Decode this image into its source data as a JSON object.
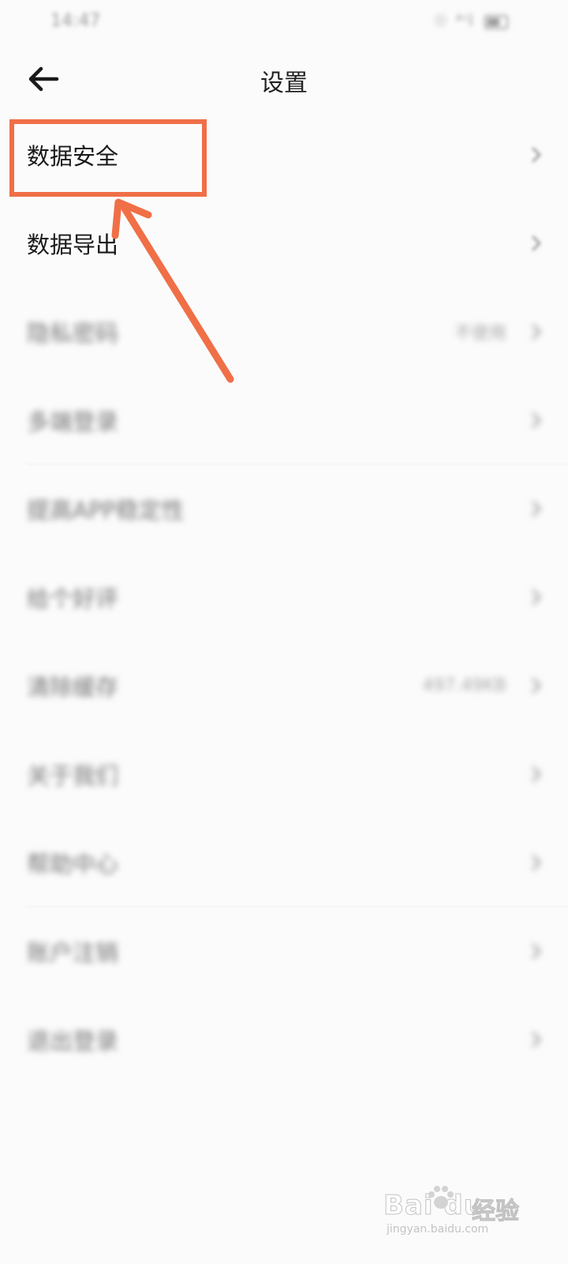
{
  "status_bar": {
    "time": "14:47",
    "icons": "☉ ᴬᴵl"
  },
  "nav": {
    "title": "设置"
  },
  "settings": [
    {
      "label": "数据安全",
      "value": "",
      "clear": true
    },
    {
      "label": "数据导出",
      "value": "",
      "clear": true
    },
    {
      "label": "隐私密码",
      "value": "不使用",
      "clear": false
    },
    {
      "label": "多端登录",
      "value": "",
      "clear": false
    },
    {
      "label": "提高APP稳定性",
      "value": "",
      "clear": false
    },
    {
      "label": "给个好评",
      "value": "",
      "clear": false
    },
    {
      "label": "清除缓存",
      "value": "497.49KB",
      "clear": false
    },
    {
      "label": "关于我们",
      "value": "",
      "clear": false
    },
    {
      "label": "帮助中心",
      "value": "",
      "clear": false
    },
    {
      "label": "账户注销",
      "value": "",
      "clear": false
    },
    {
      "label": "退出登录",
      "value": "",
      "clear": false
    }
  ],
  "battery_level": 0.7,
  "watermark": {
    "brand": "Bai du",
    "cn": "经验",
    "url": "jingyan.baidu.com"
  },
  "colors": {
    "annotation": "#f06f47",
    "background": "#fbfbfb"
  }
}
